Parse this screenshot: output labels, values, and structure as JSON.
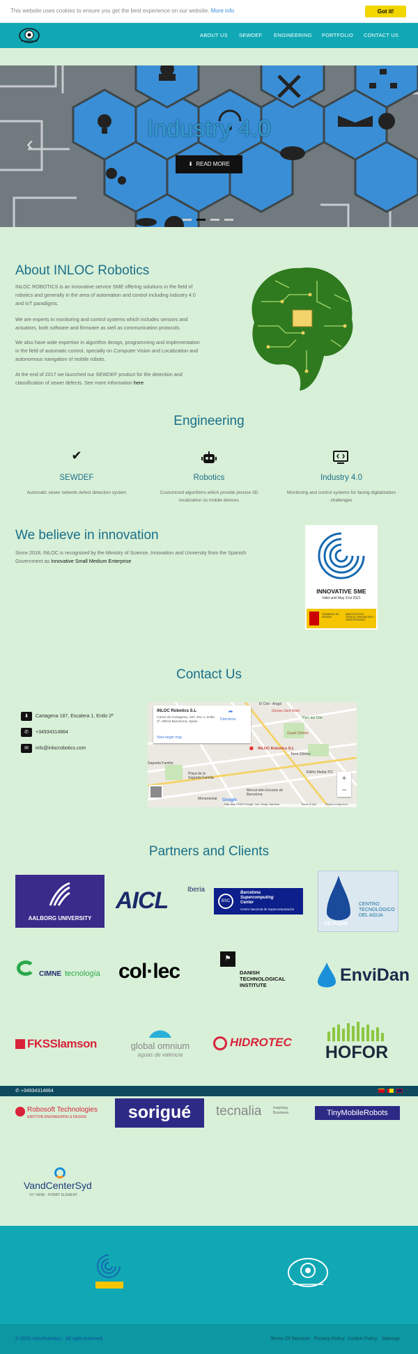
{
  "cookie": {
    "message": "This website uses cookies to ensure you get the best experience on our website.",
    "more_info": "More info",
    "accept": "Got it!"
  },
  "nav": {
    "items": [
      "ABOUT US",
      "SEWDEF",
      "ENGINEERING",
      "PORTFOLIO",
      "CONTACT US"
    ]
  },
  "hero": {
    "title": "Industry 4.0",
    "button": "READ MORE",
    "slides": 4,
    "active_slide": 2
  },
  "about": {
    "title": "About INLOC Robotics",
    "p1": "INLOC ROBOTICS is an innovative service SME offering solutions in the field of robotics and generally in the area of automation and control including industry 4.0 and IoT paradigms.",
    "p2": "We are experts in monitoring and control systems which includes sensors and actuators, both software and firmware as well as communication protocols.",
    "p3": "We also have wide expertise in algorithm design, programming and implementation in the field of automatic control, specially on Computer Vision and Localization and autonomous navigation of mobile robots.",
    "p4": "At the end of 2017 we launched our SEWDEF product for the detection and classification of sewer defects. See more information",
    "p4_link": "here"
  },
  "engineering": {
    "title": "Engineering",
    "items": [
      {
        "icon": "check-icon",
        "title": "SEWDEF",
        "desc": "Automatic sewer network defect detection system"
      },
      {
        "icon": "robot-icon",
        "title": "Robotics",
        "desc": "Customized algorithms which provide precise 3D localization os mobile devices"
      },
      {
        "icon": "monitor-code-icon",
        "title": "Industry 4.0",
        "desc": "Monitoring and control systems for facing digitalization challenges"
      }
    ]
  },
  "innovation": {
    "title": "We believe in innovation",
    "text": "Since 2018, INLOC is recognized by the Ministry of Science, Innovation and University from the Spanish Government as",
    "link": "Innovative Small Medium Enterprise",
    "badge_title": "INNOVATIVE SME",
    "badge_valid": "Valid until May 31st 2021",
    "badge_gov": "GOBIERNO DE ESPAÑA",
    "badge_ministry": "MINISTERIO DE CIENCIA, INNOVACIÓN Y UNIVERSIDADES"
  },
  "contact": {
    "title": "Contact Us",
    "address": "Cartagena 187, Escalera 1, Entlo 2ª",
    "phone": "+34934314864",
    "email": "info@inlocrobotics.com",
    "map": {
      "name": "INLOC Robotics S.L",
      "addr": "Carrer de Cartagena, 187, Esc.1, Entlo. 2ª, 08013 Barcelona, Spain",
      "directions": "Directions",
      "larger": "View larger map",
      "pin_label": "INLOC Robotics S.L",
      "labels": [
        "El Clot - Aragó",
        "Parc del Clot",
        "Glorias Sant Martí",
        "Gaudí Glòries",
        "Torre Glòries",
        "Edifici Media-TIC",
        "Sagrada Familia",
        "Plaça de la Sagrada Família",
        "Mercat dels Encants de Barcelona",
        "Monumental"
      ],
      "attribution": "Map data ©2020 Google, Inst. Geogr. Nacional",
      "terms": "Terms of Use",
      "report": "Report a map error",
      "google": "Google"
    }
  },
  "partners": {
    "title": "Partners and Clients",
    "logos": [
      {
        "name": "AALBORG UNIVERSITY"
      },
      {
        "name": "AICL",
        "sub": "Iberia"
      },
      {
        "name": "Barcelona Supercomputing Center",
        "sub": "Centro Nacional de Supercomputación"
      },
      {
        "name": "CETAQUA",
        "sub": "CENTRO TECNOLÓGICO DEL AGUA"
      },
      {
        "name": "CIMNE",
        "sub": "tecnología"
      },
      {
        "name": "col·lec"
      },
      {
        "name": "DANISH TECHNOLOGICAL INSTITUTE"
      },
      {
        "name": "EnviDan"
      },
      {
        "name": "FKSSlamson"
      },
      {
        "name": "global omnium",
        "sub": "aguas de valencia"
      },
      {
        "name": "HIDROTEC"
      },
      {
        "name": "HOFOR"
      },
      {
        "name": "Robosoft Technologies",
        "sub": "EMOTION ENGINEERING & DESIGN"
      },
      {
        "name": "sorigué"
      },
      {
        "name": "tecnalia",
        "sub": "Inspiring Business"
      },
      {
        "name": "TinyMobileRobots"
      },
      {
        "name": "VandCenterSyd",
        "sub": "VI7 VAND - HOBBY ELEMENT"
      }
    ]
  },
  "topbar": {
    "phone": "+34934314864"
  },
  "footer": {
    "copyright": "© 2020 InlocRobotics . All right reserved.",
    "links": [
      "Terms Of Services",
      "Privacy Policy",
      "Cookie Policy",
      "Sitemap"
    ]
  },
  "colors": {
    "teal": "#10a8b4",
    "heading": "#1a6f89",
    "background": "#d8f0d8",
    "cookie_button": "#f1d600"
  }
}
